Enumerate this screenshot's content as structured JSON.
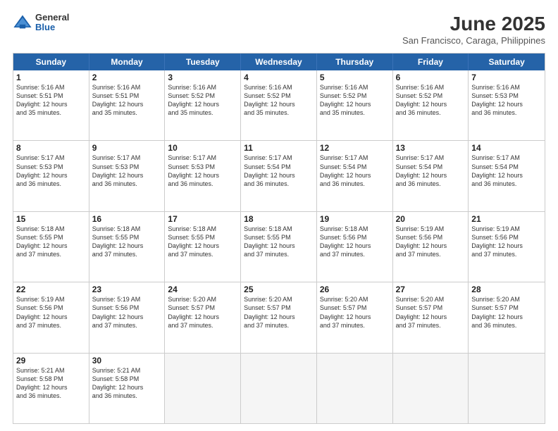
{
  "logo": {
    "general": "General",
    "blue": "Blue"
  },
  "title": "June 2025",
  "subtitle": "San Francisco, Caraga, Philippines",
  "days": [
    "Sunday",
    "Monday",
    "Tuesday",
    "Wednesday",
    "Thursday",
    "Friday",
    "Saturday"
  ],
  "rows": [
    [
      {
        "day": "1",
        "info": "Sunrise: 5:16 AM\nSunset: 5:51 PM\nDaylight: 12 hours\nand 35 minutes."
      },
      {
        "day": "2",
        "info": "Sunrise: 5:16 AM\nSunset: 5:51 PM\nDaylight: 12 hours\nand 35 minutes."
      },
      {
        "day": "3",
        "info": "Sunrise: 5:16 AM\nSunset: 5:52 PM\nDaylight: 12 hours\nand 35 minutes."
      },
      {
        "day": "4",
        "info": "Sunrise: 5:16 AM\nSunset: 5:52 PM\nDaylight: 12 hours\nand 35 minutes."
      },
      {
        "day": "5",
        "info": "Sunrise: 5:16 AM\nSunset: 5:52 PM\nDaylight: 12 hours\nand 35 minutes."
      },
      {
        "day": "6",
        "info": "Sunrise: 5:16 AM\nSunset: 5:52 PM\nDaylight: 12 hours\nand 36 minutes."
      },
      {
        "day": "7",
        "info": "Sunrise: 5:16 AM\nSunset: 5:53 PM\nDaylight: 12 hours\nand 36 minutes."
      }
    ],
    [
      {
        "day": "8",
        "info": "Sunrise: 5:17 AM\nSunset: 5:53 PM\nDaylight: 12 hours\nand 36 minutes."
      },
      {
        "day": "9",
        "info": "Sunrise: 5:17 AM\nSunset: 5:53 PM\nDaylight: 12 hours\nand 36 minutes."
      },
      {
        "day": "10",
        "info": "Sunrise: 5:17 AM\nSunset: 5:53 PM\nDaylight: 12 hours\nand 36 minutes."
      },
      {
        "day": "11",
        "info": "Sunrise: 5:17 AM\nSunset: 5:54 PM\nDaylight: 12 hours\nand 36 minutes."
      },
      {
        "day": "12",
        "info": "Sunrise: 5:17 AM\nSunset: 5:54 PM\nDaylight: 12 hours\nand 36 minutes."
      },
      {
        "day": "13",
        "info": "Sunrise: 5:17 AM\nSunset: 5:54 PM\nDaylight: 12 hours\nand 36 minutes."
      },
      {
        "day": "14",
        "info": "Sunrise: 5:17 AM\nSunset: 5:54 PM\nDaylight: 12 hours\nand 36 minutes."
      }
    ],
    [
      {
        "day": "15",
        "info": "Sunrise: 5:18 AM\nSunset: 5:55 PM\nDaylight: 12 hours\nand 37 minutes."
      },
      {
        "day": "16",
        "info": "Sunrise: 5:18 AM\nSunset: 5:55 PM\nDaylight: 12 hours\nand 37 minutes."
      },
      {
        "day": "17",
        "info": "Sunrise: 5:18 AM\nSunset: 5:55 PM\nDaylight: 12 hours\nand 37 minutes."
      },
      {
        "day": "18",
        "info": "Sunrise: 5:18 AM\nSunset: 5:55 PM\nDaylight: 12 hours\nand 37 minutes."
      },
      {
        "day": "19",
        "info": "Sunrise: 5:18 AM\nSunset: 5:56 PM\nDaylight: 12 hours\nand 37 minutes."
      },
      {
        "day": "20",
        "info": "Sunrise: 5:19 AM\nSunset: 5:56 PM\nDaylight: 12 hours\nand 37 minutes."
      },
      {
        "day": "21",
        "info": "Sunrise: 5:19 AM\nSunset: 5:56 PM\nDaylight: 12 hours\nand 37 minutes."
      }
    ],
    [
      {
        "day": "22",
        "info": "Sunrise: 5:19 AM\nSunset: 5:56 PM\nDaylight: 12 hours\nand 37 minutes."
      },
      {
        "day": "23",
        "info": "Sunrise: 5:19 AM\nSunset: 5:56 PM\nDaylight: 12 hours\nand 37 minutes."
      },
      {
        "day": "24",
        "info": "Sunrise: 5:20 AM\nSunset: 5:57 PM\nDaylight: 12 hours\nand 37 minutes."
      },
      {
        "day": "25",
        "info": "Sunrise: 5:20 AM\nSunset: 5:57 PM\nDaylight: 12 hours\nand 37 minutes."
      },
      {
        "day": "26",
        "info": "Sunrise: 5:20 AM\nSunset: 5:57 PM\nDaylight: 12 hours\nand 37 minutes."
      },
      {
        "day": "27",
        "info": "Sunrise: 5:20 AM\nSunset: 5:57 PM\nDaylight: 12 hours\nand 37 minutes."
      },
      {
        "day": "28",
        "info": "Sunrise: 5:20 AM\nSunset: 5:57 PM\nDaylight: 12 hours\nand 36 minutes."
      }
    ],
    [
      {
        "day": "29",
        "info": "Sunrise: 5:21 AM\nSunset: 5:58 PM\nDaylight: 12 hours\nand 36 minutes."
      },
      {
        "day": "30",
        "info": "Sunrise: 5:21 AM\nSunset: 5:58 PM\nDaylight: 12 hours\nand 36 minutes."
      },
      {
        "day": "",
        "info": ""
      },
      {
        "day": "",
        "info": ""
      },
      {
        "day": "",
        "info": ""
      },
      {
        "day": "",
        "info": ""
      },
      {
        "day": "",
        "info": ""
      }
    ]
  ]
}
